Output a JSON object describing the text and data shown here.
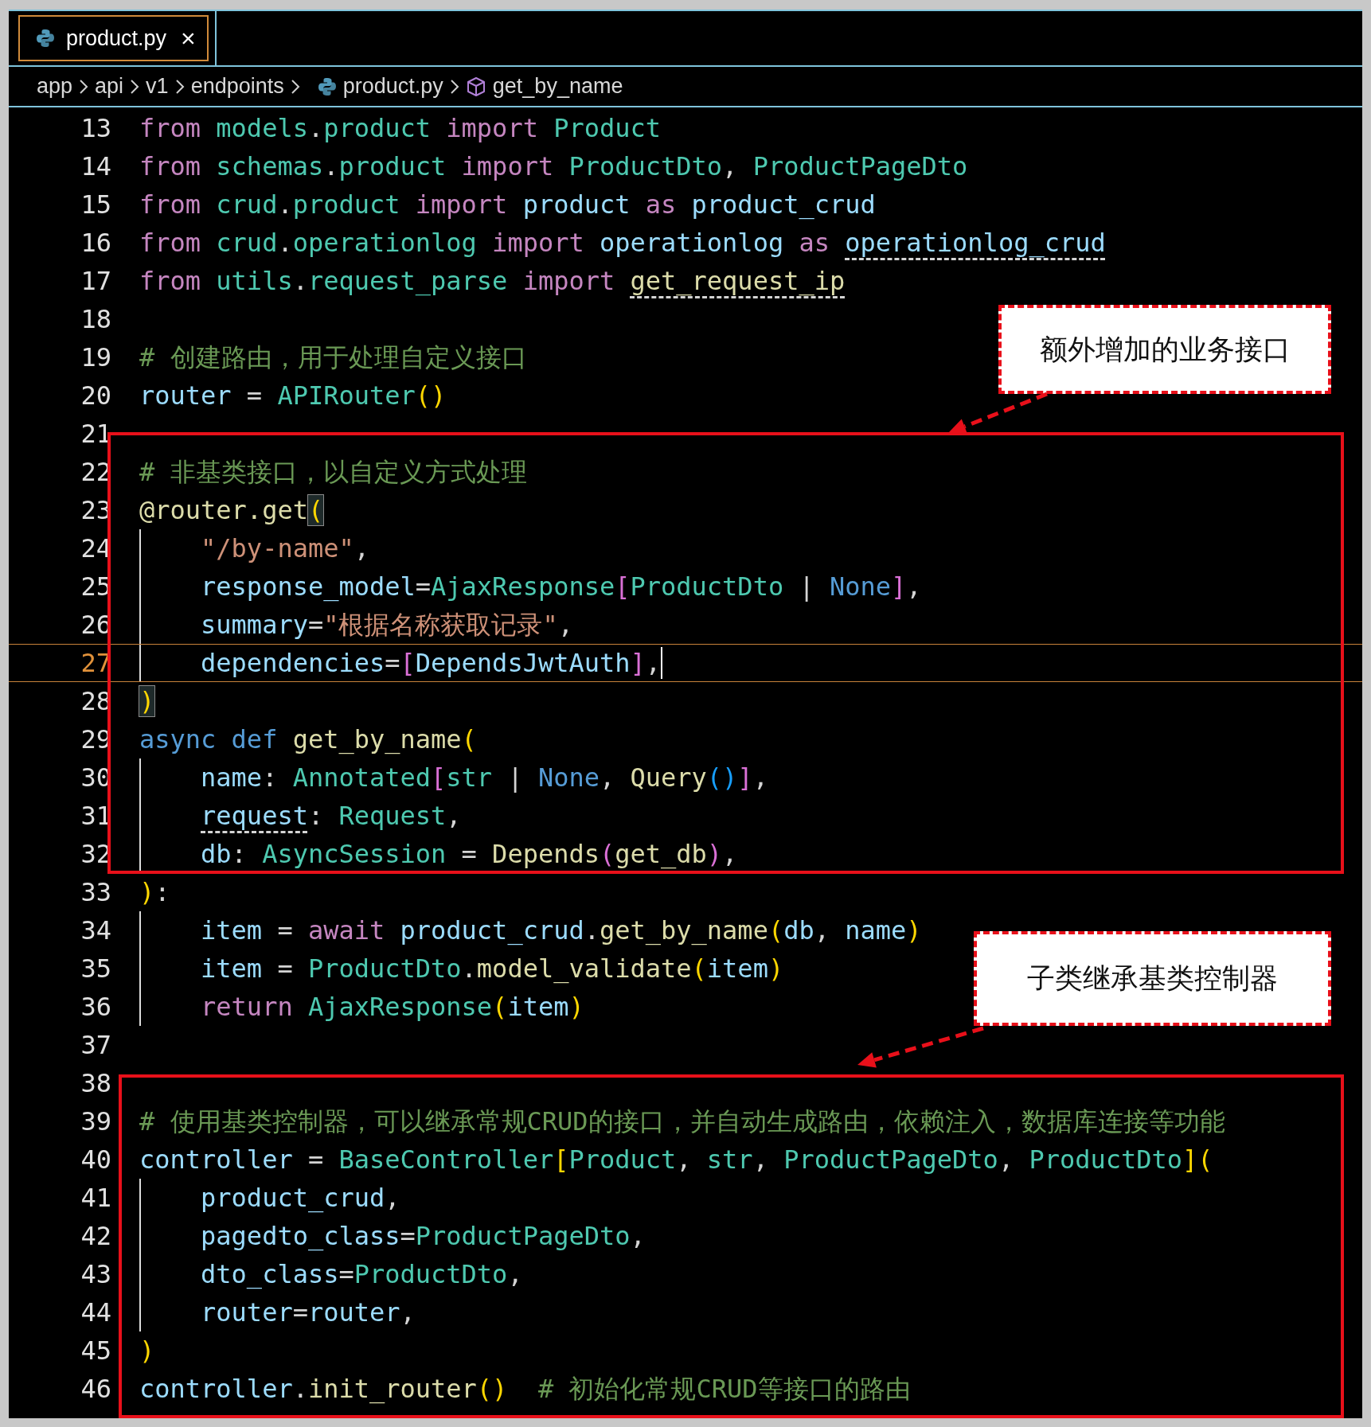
{
  "tabs": [
    {
      "label": "product.py",
      "close": "×",
      "selected": true
    }
  ],
  "breadcrumb": [
    {
      "text": "app",
      "kind": "folder"
    },
    {
      "text": "api",
      "kind": "folder"
    },
    {
      "text": "v1",
      "kind": "folder"
    },
    {
      "text": "endpoints",
      "kind": "folder"
    },
    {
      "text": "product.py",
      "kind": "file"
    },
    {
      "text": "get_by_name",
      "kind": "symbol"
    }
  ],
  "lines": [
    {
      "number": "13",
      "tokens": [
        {
          "text": "from",
          "kind": "keyword"
        },
        {
          "text": " models",
          "kind": "type"
        },
        {
          "text": ".",
          "kind": "plain"
        },
        {
          "text": "product",
          "kind": "type"
        },
        {
          "text": " import",
          "kind": "keyword"
        },
        {
          "text": " Product",
          "kind": "type"
        }
      ]
    },
    {
      "number": "14",
      "tokens": [
        {
          "text": "from",
          "kind": "keyword"
        },
        {
          "text": " schemas",
          "kind": "type"
        },
        {
          "text": ".",
          "kind": "plain"
        },
        {
          "text": "product",
          "kind": "type"
        },
        {
          "text": " import",
          "kind": "keyword"
        },
        {
          "text": " ProductDto",
          "kind": "type"
        },
        {
          "text": ",",
          "kind": "plain"
        },
        {
          "text": " ProductPageDto",
          "kind": "type"
        }
      ]
    },
    {
      "number": "15",
      "tokens": [
        {
          "text": "from",
          "kind": "keyword"
        },
        {
          "text": " crud",
          "kind": "type"
        },
        {
          "text": ".",
          "kind": "plain"
        },
        {
          "text": "product",
          "kind": "type"
        },
        {
          "text": " import",
          "kind": "keyword"
        },
        {
          "text": " product",
          "kind": "variable"
        },
        {
          "text": " as",
          "kind": "keyword"
        },
        {
          "text": " product_crud",
          "kind": "variable"
        }
      ]
    },
    {
      "number": "16",
      "tokens": [
        {
          "text": "from",
          "kind": "keyword"
        },
        {
          "text": " crud",
          "kind": "type"
        },
        {
          "text": ".",
          "kind": "plain"
        },
        {
          "text": "operationlog",
          "kind": "type"
        },
        {
          "text": " import",
          "kind": "keyword"
        },
        {
          "text": " operationlog",
          "kind": "variable"
        },
        {
          "text": " as ",
          "kind": "keyword"
        },
        {
          "text": "operationlog_crud",
          "kind": "variable",
          "underlined": true
        }
      ]
    },
    {
      "number": "17",
      "tokens": [
        {
          "text": "from",
          "kind": "keyword"
        },
        {
          "text": " utils",
          "kind": "type"
        },
        {
          "text": ".",
          "kind": "plain"
        },
        {
          "text": "request_parse",
          "kind": "type"
        },
        {
          "text": " import ",
          "kind": "keyword"
        },
        {
          "text": "get_request_ip",
          "kind": "function",
          "underlined": true
        }
      ]
    },
    {
      "number": "18"
    },
    {
      "number": "19",
      "tokens": [
        {
          "text": "# 创建路由，用于处理自定义接口",
          "kind": "comment"
        }
      ]
    },
    {
      "number": "20",
      "tokens": [
        {
          "text": "router",
          "kind": "variable"
        },
        {
          "text": " = ",
          "kind": "plain"
        },
        {
          "text": "APIRouter",
          "kind": "type"
        },
        {
          "text": "()",
          "kind": "bracket"
        }
      ]
    },
    {
      "number": "21"
    },
    {
      "number": "22",
      "tokens": [
        {
          "text": "# 非基类接口，以自定义方式处理",
          "kind": "comment"
        }
      ]
    },
    {
      "number": "23",
      "tokens": [
        {
          "text": "@router.get",
          "kind": "function"
        },
        {
          "text": "(",
          "kind": "bracket",
          "matched": true
        }
      ]
    },
    {
      "number": "24",
      "indented": true,
      "tokens": [
        {
          "text": "\"/by-name\"",
          "kind": "string"
        },
        {
          "text": ",",
          "kind": "plain"
        }
      ]
    },
    {
      "number": "25",
      "indented": true,
      "tokens": [
        {
          "text": "response_model",
          "kind": "variable"
        },
        {
          "text": "=",
          "kind": "plain"
        },
        {
          "text": "AjaxResponse",
          "kind": "type"
        },
        {
          "text": "[",
          "kind": "bracket2"
        },
        {
          "text": "ProductDto",
          "kind": "type"
        },
        {
          "text": " | ",
          "kind": "plain"
        },
        {
          "text": "None",
          "kind": "storage"
        },
        {
          "text": "]",
          "kind": "bracket2"
        },
        {
          "text": ",",
          "kind": "plain"
        }
      ]
    },
    {
      "number": "26",
      "indented": true,
      "tokens": [
        {
          "text": "summary",
          "kind": "variable"
        },
        {
          "text": "=",
          "kind": "plain"
        },
        {
          "text": "\"根据名称获取记录\"",
          "kind": "string"
        },
        {
          "text": ",",
          "kind": "plain"
        }
      ]
    },
    {
      "number": "27",
      "indented": true,
      "current": true,
      "tokens": [
        {
          "text": "dependencies",
          "kind": "variable"
        },
        {
          "text": "=",
          "kind": "plain"
        },
        {
          "text": "[",
          "kind": "bracket2"
        },
        {
          "text": "DependsJwtAuth",
          "kind": "variable"
        },
        {
          "text": "]",
          "kind": "bracket2"
        },
        {
          "text": ",",
          "kind": "plain"
        }
      ]
    },
    {
      "number": "28",
      "tokens": [
        {
          "text": ")",
          "kind": "bracket",
          "matched": true
        }
      ]
    },
    {
      "number": "29",
      "tokens": [
        {
          "text": "async def",
          "kind": "storage"
        },
        {
          "text": " get_by_name",
          "kind": "function"
        },
        {
          "text": "(",
          "kind": "bracket"
        }
      ]
    },
    {
      "number": "30",
      "indented": true,
      "tokens": [
        {
          "text": "name",
          "kind": "variable"
        },
        {
          "text": ": ",
          "kind": "plain"
        },
        {
          "text": "Annotated",
          "kind": "type"
        },
        {
          "text": "[",
          "kind": "bracket2"
        },
        {
          "text": "str",
          "kind": "type"
        },
        {
          "text": " | ",
          "kind": "plain"
        },
        {
          "text": "None",
          "kind": "storage"
        },
        {
          "text": ", ",
          "kind": "plain"
        },
        {
          "text": "Query",
          "kind": "function"
        },
        {
          "text": "()",
          "kind": "bracket3"
        },
        {
          "text": "]",
          "kind": "bracket2"
        },
        {
          "text": ",",
          "kind": "plain"
        }
      ]
    },
    {
      "number": "31",
      "indented": true,
      "tokens": [
        {
          "text": "request",
          "kind": "variable",
          "underlined": true
        },
        {
          "text": ": ",
          "kind": "plain"
        },
        {
          "text": "Request",
          "kind": "type"
        },
        {
          "text": ",",
          "kind": "plain"
        }
      ]
    },
    {
      "number": "32",
      "indented": true,
      "tokens": [
        {
          "text": "db",
          "kind": "variable"
        },
        {
          "text": ": ",
          "kind": "plain"
        },
        {
          "text": "AsyncSession",
          "kind": "type"
        },
        {
          "text": " = ",
          "kind": "plain"
        },
        {
          "text": "Depends",
          "kind": "function"
        },
        {
          "text": "(",
          "kind": "bracket2"
        },
        {
          "text": "get_db",
          "kind": "function"
        },
        {
          "text": ")",
          "kind": "bracket2"
        },
        {
          "text": ",",
          "kind": "plain"
        }
      ]
    },
    {
      "number": "33",
      "tokens": [
        {
          "text": ")",
          "kind": "bracket"
        },
        {
          "text": ":",
          "kind": "plain"
        }
      ]
    },
    {
      "number": "34",
      "indented": true,
      "tokens": [
        {
          "text": "item",
          "kind": "variable"
        },
        {
          "text": " = ",
          "kind": "plain"
        },
        {
          "text": "await",
          "kind": "keyword"
        },
        {
          "text": " product_crud",
          "kind": "variable"
        },
        {
          "text": ".",
          "kind": "plain"
        },
        {
          "text": "get_by_name",
          "kind": "function"
        },
        {
          "text": "(",
          "kind": "bracket"
        },
        {
          "text": "db",
          "kind": "variable"
        },
        {
          "text": ", ",
          "kind": "plain"
        },
        {
          "text": "name",
          "kind": "variable"
        },
        {
          "text": ")",
          "kind": "bracket"
        }
      ]
    },
    {
      "number": "35",
      "indented": true,
      "tokens": [
        {
          "text": "item",
          "kind": "variable"
        },
        {
          "text": " = ",
          "kind": "plain"
        },
        {
          "text": "ProductDto",
          "kind": "type"
        },
        {
          "text": ".",
          "kind": "plain"
        },
        {
          "text": "model_validate",
          "kind": "function"
        },
        {
          "text": "(",
          "kind": "bracket"
        },
        {
          "text": "item",
          "kind": "variable"
        },
        {
          "text": ")",
          "kind": "bracket"
        }
      ]
    },
    {
      "number": "36",
      "indented": true,
      "tokens": [
        {
          "text": "return",
          "kind": "keyword"
        },
        {
          "text": " AjaxResponse",
          "kind": "type"
        },
        {
          "text": "(",
          "kind": "bracket"
        },
        {
          "text": "item",
          "kind": "variable"
        },
        {
          "text": ")",
          "kind": "bracket"
        }
      ]
    },
    {
      "number": "37"
    },
    {
      "number": "38"
    },
    {
      "number": "39",
      "tokens": [
        {
          "text": "# 使用基类控制器，可以继承常规CRUD的接口，并自动生成路由，依赖注入，数据库连接等功能",
          "kind": "comment"
        }
      ]
    },
    {
      "number": "40",
      "tokens": [
        {
          "text": "controller",
          "kind": "variable"
        },
        {
          "text": " = ",
          "kind": "plain"
        },
        {
          "text": "BaseController",
          "kind": "type"
        },
        {
          "text": "[",
          "kind": "bracket"
        },
        {
          "text": "Product",
          "kind": "type"
        },
        {
          "text": ", ",
          "kind": "plain"
        },
        {
          "text": "str",
          "kind": "type"
        },
        {
          "text": ", ",
          "kind": "plain"
        },
        {
          "text": "ProductPageDto",
          "kind": "type"
        },
        {
          "text": ", ",
          "kind": "plain"
        },
        {
          "text": "ProductDto",
          "kind": "type"
        },
        {
          "text": "](",
          "kind": "bracket"
        }
      ]
    },
    {
      "number": "41",
      "indented": true,
      "tokens": [
        {
          "text": "product_crud",
          "kind": "variable"
        },
        {
          "text": ",",
          "kind": "plain"
        }
      ]
    },
    {
      "number": "42",
      "indented": true,
      "tokens": [
        {
          "text": "pagedto_class",
          "kind": "variable"
        },
        {
          "text": "=",
          "kind": "plain"
        },
        {
          "text": "ProductPageDto",
          "kind": "type"
        },
        {
          "text": ",",
          "kind": "plain"
        }
      ]
    },
    {
      "number": "43",
      "indented": true,
      "tokens": [
        {
          "text": "dto_class",
          "kind": "variable"
        },
        {
          "text": "=",
          "kind": "plain"
        },
        {
          "text": "ProductDto",
          "kind": "type"
        },
        {
          "text": ",",
          "kind": "plain"
        }
      ]
    },
    {
      "number": "44",
      "indented": true,
      "tokens": [
        {
          "text": "router",
          "kind": "variable"
        },
        {
          "text": "=",
          "kind": "plain"
        },
        {
          "text": "router",
          "kind": "variable"
        },
        {
          "text": ",",
          "kind": "plain"
        }
      ]
    },
    {
      "number": "45",
      "tokens": [
        {
          "text": ")",
          "kind": "bracket"
        }
      ]
    },
    {
      "number": "46",
      "tokens": [
        {
          "text": "controller",
          "kind": "variable"
        },
        {
          "text": ".",
          "kind": "plain"
        },
        {
          "text": "init_router",
          "kind": "function"
        },
        {
          "text": "()",
          "kind": "bracket"
        },
        {
          "text": "  # 初始化常规CRUD等接口的路由",
          "kind": "comment"
        }
      ]
    }
  ],
  "annotations": [
    {
      "text": "额外增加的业务接口"
    },
    {
      "text": "子类继承基类控制器"
    }
  ]
}
